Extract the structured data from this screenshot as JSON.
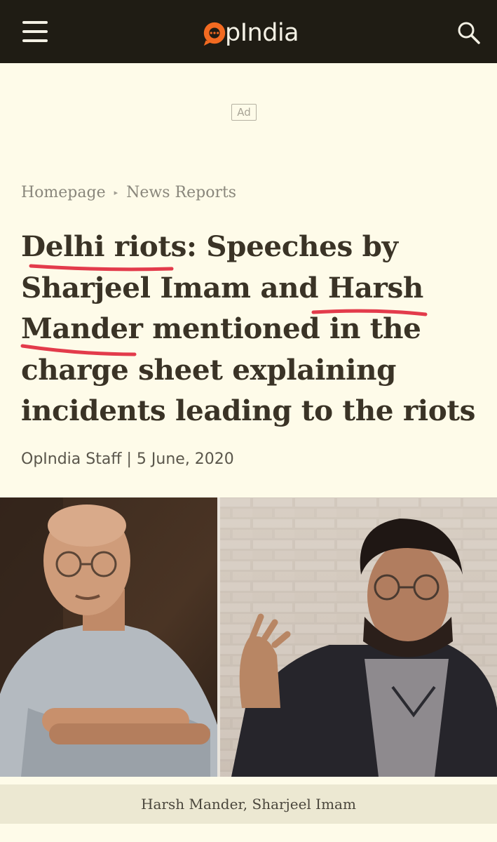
{
  "header": {
    "logo_text": "pIndia",
    "menu_icon": "hamburger-menu-icon",
    "search_icon": "search-icon"
  },
  "ad": {
    "label": "Ad"
  },
  "breadcrumb": {
    "items": [
      "Homepage",
      "News Reports"
    ]
  },
  "article": {
    "title": "Delhi riots: Speeches by Sharjeel Imam and Harsh Mander mentioned in the charge sheet explaining incidents leading to the riots",
    "author": "OpIndia Staff",
    "separator": "|",
    "date": "5 June, 2020",
    "image_caption": "Harsh Mander, Sharjeel Imam"
  },
  "colors": {
    "header_bg": "#1f1c14",
    "page_bg": "#fefbe9",
    "logo_accent": "#f26a21",
    "annotation_red": "#e0263a"
  }
}
